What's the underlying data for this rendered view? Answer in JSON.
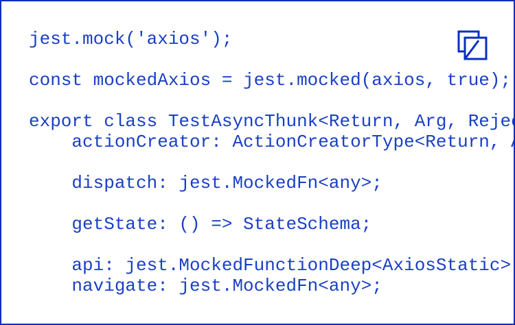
{
  "code": {
    "lines": [
      "jest.mock('axios');",
      "const mockedAxios = jest.mocked(axios, true);",
      "export class TestAsyncThunk<Return, Arg, RejectedValue> {",
      "    actionCreator: ActionCreatorType<Return, Arg, RejectedValue>;",
      "    dispatch: jest.MockedFn<any>;",
      "    getState: () => StateSchema;",
      "    api: jest.MockedFunctionDeep<AxiosStatic>;",
      "    navigate: jest.MockedFn<any>;"
    ]
  },
  "toolbar": {
    "copy_icon": "copy-icon"
  },
  "colors": {
    "accent": "#1a3fc4",
    "border": "#0a2fbf",
    "background": "#ffffff"
  }
}
